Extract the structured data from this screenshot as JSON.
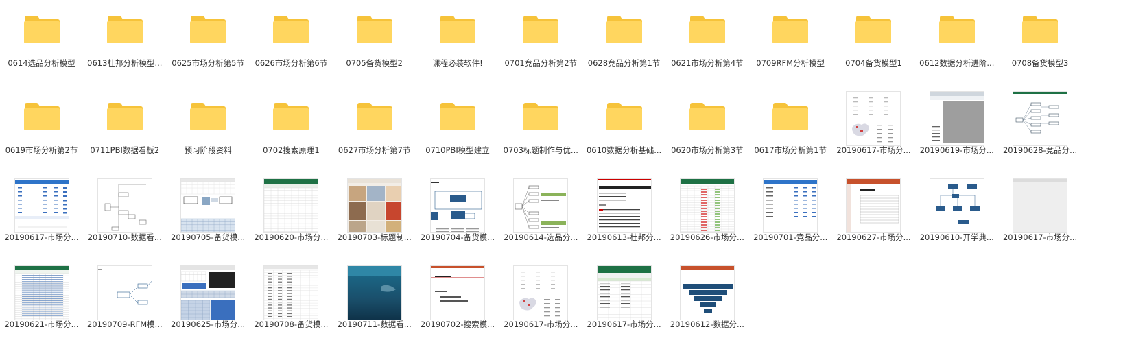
{
  "colors": {
    "folder_body": "#ffd65f",
    "folder_tab": "#f6c33a",
    "label_text": "#333333",
    "excel_green": "#1e7145",
    "excel_blue": "#2e74c9",
    "ppt_orange": "#c7512c",
    "map_blue": "#2a5b8c"
  },
  "items": [
    {
      "type": "folder",
      "label": "0614选品分析模型"
    },
    {
      "type": "folder",
      "label": "0613杜邦分析模型..."
    },
    {
      "type": "folder",
      "label": "0625市场分析第5节"
    },
    {
      "type": "folder",
      "label": "0626市场分析第6节"
    },
    {
      "type": "folder",
      "label": "0705备货模型2"
    },
    {
      "type": "folder",
      "label": "课程必装软件!"
    },
    {
      "type": "folder",
      "label": "0701竞品分析第2节"
    },
    {
      "type": "folder",
      "label": "0628竞品分析第1节"
    },
    {
      "type": "folder",
      "label": "0621市场分析第4节"
    },
    {
      "type": "folder",
      "label": "0709RFM分析模型"
    },
    {
      "type": "folder",
      "label": "0704备货模型1"
    },
    {
      "type": "folder",
      "label": "0612数据分析进阶..."
    },
    {
      "type": "folder",
      "label": "0708备货模型3"
    },
    {
      "type": "folder",
      "label": "0619市场分析第2节"
    },
    {
      "type": "folder",
      "label": "0711PBI数据看板2"
    },
    {
      "type": "folder",
      "label": "预习阶段资料"
    },
    {
      "type": "folder",
      "label": "0702搜索原理1"
    },
    {
      "type": "folder",
      "label": "0627市场分析第7节"
    },
    {
      "type": "folder",
      "label": "0710PBI模型建立"
    },
    {
      "type": "folder",
      "label": "0703标题制作与优..."
    },
    {
      "type": "folder",
      "label": "0610数据分析基础..."
    },
    {
      "type": "folder",
      "label": "0620市场分析第3节"
    },
    {
      "type": "folder",
      "label": "0617市场分析第1节"
    },
    {
      "type": "file",
      "thumb": "map-table",
      "label": "20190617-市场分..."
    },
    {
      "type": "file",
      "thumb": "gray-screen",
      "label": "20190619-市场分..."
    },
    {
      "type": "file",
      "thumb": "mindmap-small",
      "label": "20190628-竞品分..."
    },
    {
      "type": "file",
      "thumb": "blue-table",
      "label": "20190617-市场分..."
    },
    {
      "type": "file",
      "thumb": "flow-gray",
      "label": "20190710-数据看..."
    },
    {
      "type": "file",
      "thumb": "excel-mixed",
      "label": "20190705-备货模..."
    },
    {
      "type": "file",
      "thumb": "excel-green",
      "label": "20190620-市场分..."
    },
    {
      "type": "file",
      "thumb": "photo-collage",
      "label": "20190703-标题制..."
    },
    {
      "type": "file",
      "thumb": "ppt-diagram",
      "label": "20190704-备货模..."
    },
    {
      "type": "file",
      "thumb": "mindmap-green",
      "label": "20190614-选品分..."
    },
    {
      "type": "file",
      "thumb": "doc-red",
      "label": "20190613-杜邦分..."
    },
    {
      "type": "file",
      "thumb": "excel-green-red",
      "label": "20190626-市场分..."
    },
    {
      "type": "file",
      "thumb": "blue-table-plain",
      "label": "20190701-竞品分..."
    },
    {
      "type": "file",
      "thumb": "ppt-table",
      "label": "20190627-市场分..."
    },
    {
      "type": "file",
      "thumb": "org-chart",
      "label": "20190610-开学典..."
    },
    {
      "type": "file",
      "thumb": "blank-sheet",
      "label": "20190617-市场分..."
    },
    {
      "type": "file",
      "thumb": "excel-green-dense",
      "label": "20190621-市场分..."
    },
    {
      "type": "file",
      "thumb": "flow-small",
      "label": "20190709-RFM模..."
    },
    {
      "type": "file",
      "thumb": "screenshot-mixed",
      "label": "20190625-市场分..."
    },
    {
      "type": "file",
      "thumb": "sheet-plain",
      "label": "20190708-备货模..."
    },
    {
      "type": "file",
      "thumb": "underwater",
      "label": "20190711-数据看..."
    },
    {
      "type": "file",
      "thumb": "ppt-text",
      "label": "20190702-搜索模..."
    },
    {
      "type": "file",
      "thumb": "map-table",
      "label": "20190617-市场分..."
    },
    {
      "type": "file",
      "thumb": "excel-ribbon",
      "label": "20190617-市场分..."
    },
    {
      "type": "file",
      "thumb": "funnel",
      "label": "20190612-数据分..."
    }
  ]
}
